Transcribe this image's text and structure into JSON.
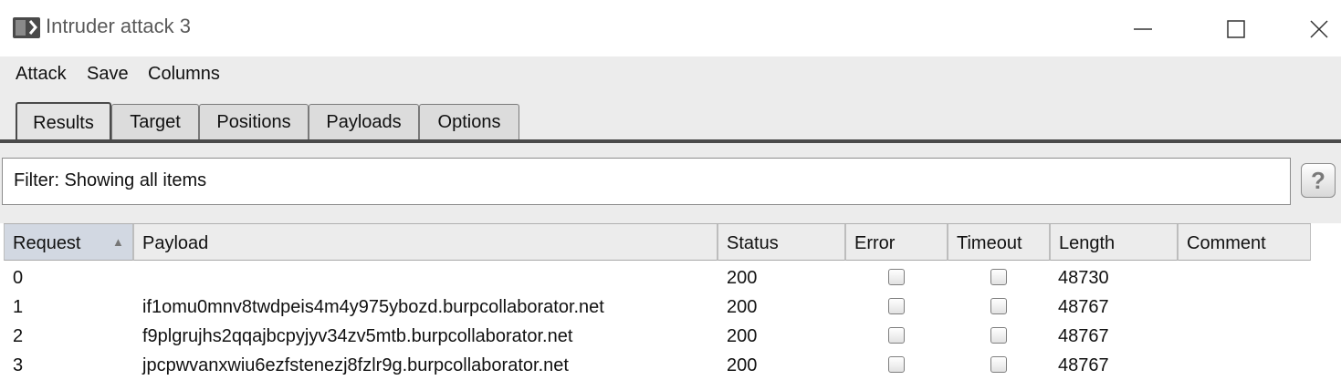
{
  "window": {
    "title": "Intruder attack 3"
  },
  "menu": [
    "Attack",
    "Save",
    "Columns"
  ],
  "tabs": [
    "Results",
    "Target",
    "Positions",
    "Payloads",
    "Options"
  ],
  "active_tab": "Results",
  "filter": {
    "text": "Filter:  Showing all items",
    "help_label": "?"
  },
  "table": {
    "sort_column": "Request",
    "sort_direction": "ascending",
    "columns": [
      "Request",
      "Payload",
      "Status",
      "Error",
      "Timeout",
      "Length",
      "Comment"
    ],
    "rows": [
      {
        "request": "0",
        "payload": "",
        "status": "200",
        "error": false,
        "timeout": false,
        "length": "48730",
        "comment": ""
      },
      {
        "request": "1",
        "payload": "if1omu0mnv8twdpeis4m4y975ybozd.burpcollaborator.net",
        "status": "200",
        "error": false,
        "timeout": false,
        "length": "48767",
        "comment": ""
      },
      {
        "request": "2",
        "payload": "f9plgrujhs2qqajbcpyjyv34zv5mtb.burpcollaborator.net",
        "status": "200",
        "error": false,
        "timeout": false,
        "length": "48767",
        "comment": ""
      },
      {
        "request": "3",
        "payload": "jpcpwvanxwiu6ezfstenezj8fzlr9g.burpcollaborator.net",
        "status": "200",
        "error": false,
        "timeout": false,
        "length": "48767",
        "comment": ""
      }
    ]
  },
  "colors": {
    "menu_bg": "#ececec",
    "sorted_header_bg": "#d2d8e2",
    "tab_underline": "#4b4b4b"
  }
}
